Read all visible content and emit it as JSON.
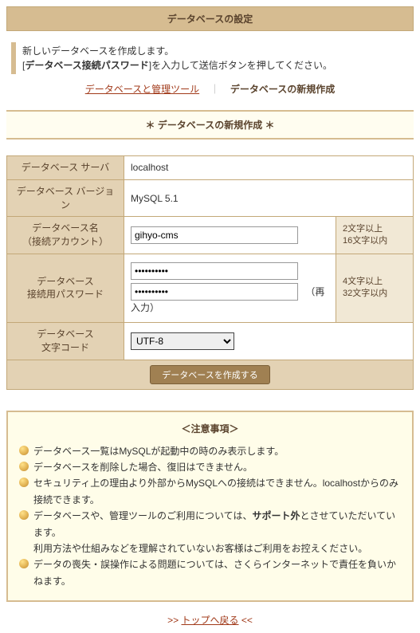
{
  "header": {
    "title": "データベースの設定"
  },
  "intro": {
    "line1": "新しいデータベースを作成します。",
    "line2_pre": "[",
    "line2_bold": "データベース接続パスワード",
    "line2_post": "]を入力して送信ボタンを押してください。"
  },
  "tabs": {
    "list_label": "データベースと管理ツール",
    "create_label": "データベースの新規作成"
  },
  "section": {
    "title": "＊ データベースの新規作成 ＊"
  },
  "form": {
    "server_label": "データベース サーバ",
    "server_value": "localhost",
    "version_label": "データベース バージョン",
    "version_value": "MySQL 5.1",
    "name_label_1": "データベース名",
    "name_label_2": "（接続アカウント）",
    "name_value": "gihyo-cms",
    "name_hint_1": "2文字以上",
    "name_hint_2": "16文字以内",
    "pw_label_1": "データベース",
    "pw_label_2": "接続用パスワード",
    "pw_value": "••••••••••",
    "pw2_value": "••••••••••",
    "pw_reinput": "（再入力）",
    "pw_hint_1": "4文字以上",
    "pw_hint_2": "32文字以内",
    "charset_label_1": "データベース",
    "charset_label_2": "文字コード",
    "charset_value": "UTF-8",
    "submit_label": "データベースを作成する"
  },
  "notice": {
    "title": "＜注意事項＞",
    "items": [
      "データベース一覧はMySQLが起動中の時のみ表示します。",
      "データベースを削除した場合、復旧はできません。",
      "セキュリティ上の理由より外部からMySQLへの接続はできません。localhostからのみ接続できます。",
      "データベースや、管理ツールのご利用については、サポート外とさせていただいています。",
      "利用方法や仕組みなどを理解されていないお客様はご利用をお控えください。",
      "データの喪失・誤操作による問題については、さくらインターネットで責任を負いかねます。"
    ],
    "bold_word": "サポート外"
  },
  "back": {
    "label": "トップへ戻る"
  }
}
